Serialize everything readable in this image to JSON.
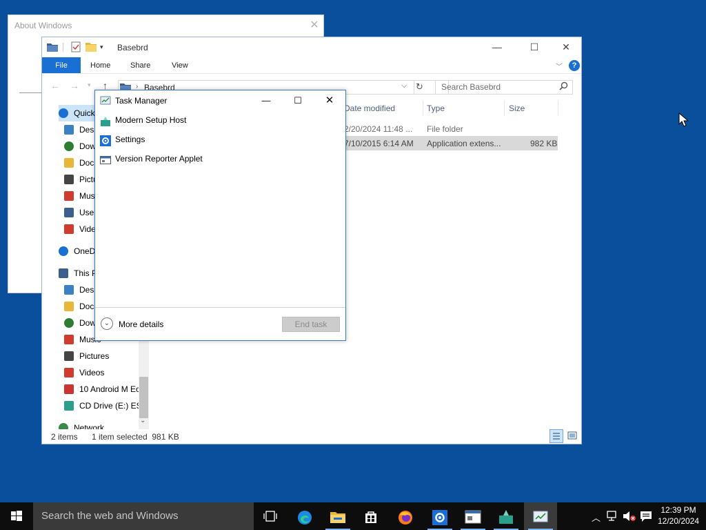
{
  "about_window": {
    "title": "About Windows"
  },
  "explorer": {
    "title": "Basebrd",
    "tabs": [
      "File",
      "Home",
      "Share",
      "View"
    ],
    "address": {
      "crumb": "Basebrd"
    },
    "search": {
      "placeholder": "Search Basebrd"
    },
    "nav_items": [
      {
        "label": "Quick access",
        "icon": "star-icon"
      },
      {
        "label": "Desktop",
        "icon": "desktop-icon"
      },
      {
        "label": "Downloads",
        "icon": "download-icon"
      },
      {
        "label": "Documents",
        "icon": "documents-icon"
      },
      {
        "label": "Pictures",
        "icon": "pictures-icon"
      },
      {
        "label": "Music",
        "icon": "music-icon"
      },
      {
        "label": "Users",
        "icon": "folder-icon"
      },
      {
        "label": "Videos",
        "icon": "videos-icon"
      },
      {
        "label": "OneDrive",
        "icon": "onedrive-icon"
      },
      {
        "label": "This PC",
        "icon": "pc-icon"
      },
      {
        "label": "Desktop",
        "icon": "desktop-icon"
      },
      {
        "label": "Documents",
        "icon": "documents-icon"
      },
      {
        "label": "Downloads",
        "icon": "download-icon"
      },
      {
        "label": "Music",
        "icon": "music-icon"
      },
      {
        "label": "Pictures",
        "icon": "pictures-icon"
      },
      {
        "label": "Videos",
        "icon": "videos-icon"
      },
      {
        "label": "10 Android M Ec",
        "icon": "drive-icon"
      },
      {
        "label": "CD Drive (E:) ESD",
        "icon": "cd-drive-icon"
      },
      {
        "label": "Network",
        "icon": "network-icon"
      }
    ],
    "columns": {
      "date": "Date modified",
      "type": "Type",
      "size": "Size"
    },
    "rows": [
      {
        "date": "2/20/2024 11:48 ...",
        "type": "File folder",
        "size": ""
      },
      {
        "date": "7/10/2015 6:14 AM",
        "type": "Application extens...",
        "size": "982 KB"
      }
    ],
    "status": {
      "items": "2 items",
      "selected": "1 item selected  981 KB"
    }
  },
  "task_manager": {
    "title": "Task Manager",
    "apps": [
      {
        "label": "Modern Setup Host",
        "icon": "setup-host-icon"
      },
      {
        "label": "Settings",
        "icon": "settings-gear-icon"
      },
      {
        "label": "Version Reporter Applet",
        "icon": "version-reporter-icon"
      }
    ],
    "more_details": "More details",
    "end_task": "End task"
  },
  "taskbar": {
    "search_placeholder": "Search the web and Windows",
    "time": "12:39 PM",
    "date": "12/20/2024"
  },
  "colors": {
    "desktop": "#0a4f9c",
    "accent": "#1a6fd4",
    "taskbar": "#0d0d0d"
  }
}
